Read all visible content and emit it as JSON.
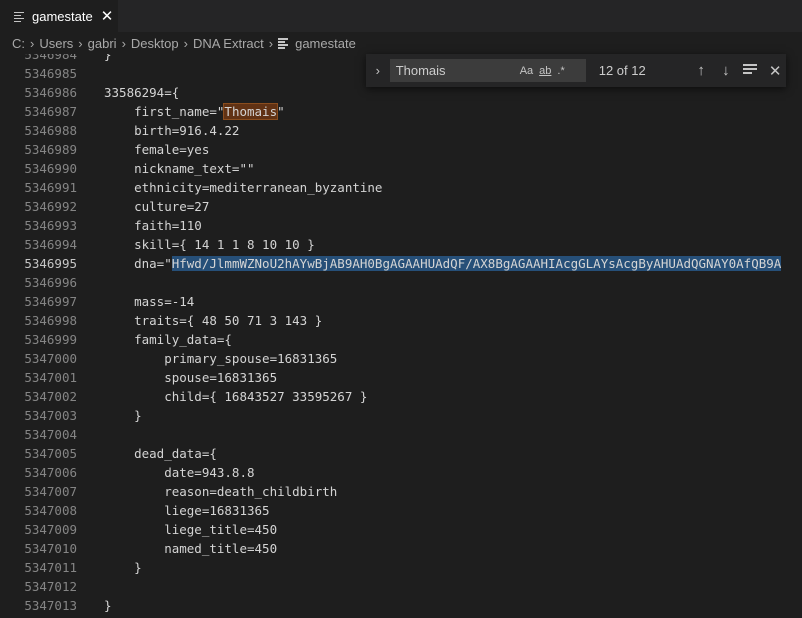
{
  "tab": {
    "label": "gamestate",
    "close": "✕",
    "icon": "file-lines-icon"
  },
  "breadcrumb": {
    "parts": [
      "C:",
      "Users",
      "gabri",
      "Desktop",
      "DNA Extract"
    ],
    "file": "gamestate",
    "separator": "›"
  },
  "find": {
    "value": "Thomais",
    "match_case": "Aa",
    "whole_word": "ab",
    "regex": ".*",
    "count": "12 of 12",
    "prev": "↑",
    "next": "↓",
    "close": "✕"
  },
  "editor": {
    "active_line": "5346995",
    "lines": [
      {
        "n": "5346984",
        "t": "}"
      },
      {
        "n": "5346985",
        "t": ""
      },
      {
        "n": "5346986",
        "t": "33586294={"
      },
      {
        "n": "5346987",
        "t": "    first_name=\"",
        "m": "Thomais",
        "a": "\""
      },
      {
        "n": "5346988",
        "t": "    birth=916.4.22"
      },
      {
        "n": "5346989",
        "t": "    female=yes"
      },
      {
        "n": "5346990",
        "t": "    nickname_text=\"\""
      },
      {
        "n": "5346991",
        "t": "    ethnicity=mediterranean_byzantine"
      },
      {
        "n": "5346992",
        "t": "    culture=27"
      },
      {
        "n": "5346993",
        "t": "    faith=110"
      },
      {
        "n": "5346994",
        "t": "    skill={ 14 1 1 8 10 10 }"
      },
      {
        "n": "5346995",
        "t": "    dna=\"",
        "s": "Hfwd/JlmmWZNoU2hAYwBjAB9AH0BgAGAAHUAdQF/AX8BgAGAAHIAcgGLAYsAcgByAHUAdQGNAY0AfQB9A"
      },
      {
        "n": "5346996",
        "t": ""
      },
      {
        "n": "5346997",
        "t": "    mass=-14"
      },
      {
        "n": "5346998",
        "t": "    traits={ 48 50 71 3 143 }"
      },
      {
        "n": "5346999",
        "t": "    family_data={"
      },
      {
        "n": "5347000",
        "t": "        primary_spouse=16831365"
      },
      {
        "n": "5347001",
        "t": "        spouse=16831365"
      },
      {
        "n": "5347002",
        "t": "        child={ 16843527 33595267 }"
      },
      {
        "n": "5347003",
        "t": "    }"
      },
      {
        "n": "5347004",
        "t": ""
      },
      {
        "n": "5347005",
        "t": "    dead_data={"
      },
      {
        "n": "5347006",
        "t": "        date=943.8.8"
      },
      {
        "n": "5347007",
        "t": "        reason=death_childbirth"
      },
      {
        "n": "5347008",
        "t": "        liege=16831365"
      },
      {
        "n": "5347009",
        "t": "        liege_title=450"
      },
      {
        "n": "5347010",
        "t": "        named_title=450"
      },
      {
        "n": "5347011",
        "t": "    }"
      },
      {
        "n": "5347012",
        "t": ""
      },
      {
        "n": "5347013",
        "t": "}"
      }
    ]
  }
}
